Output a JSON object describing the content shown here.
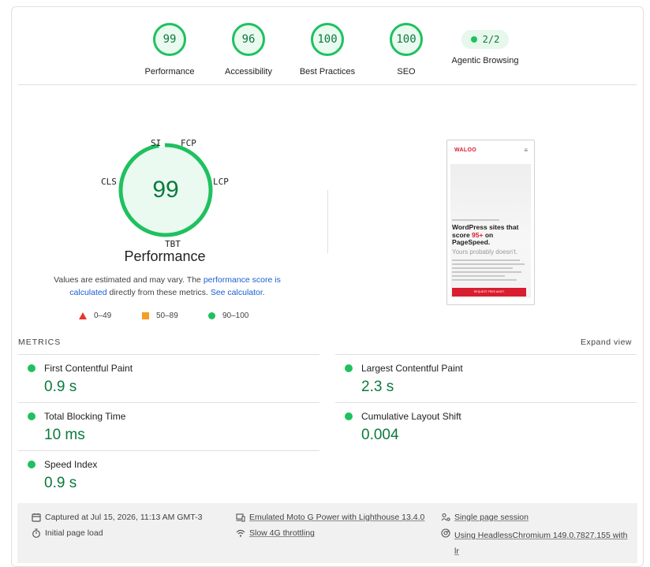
{
  "top_gauges": [
    {
      "score": "99",
      "label": "Performance"
    },
    {
      "score": "96",
      "label": "Accessibility"
    },
    {
      "score": "100",
      "label": "Best Practices"
    },
    {
      "score": "100",
      "label": "SEO"
    },
    {
      "score": "2/2",
      "label": "Agentic Browsing"
    }
  ],
  "performance": {
    "score": "99",
    "title": "Performance",
    "gauge_labels": {
      "si": "SI",
      "fcp": "FCP",
      "lcp": "LCP",
      "tbt": "TBT",
      "cls": "CLS"
    },
    "desc_1": "Values are estimated and may vary. The ",
    "desc_link_1": "performance score is calculated",
    "desc_2": " directly from these metrics. ",
    "desc_link_2": "See calculator",
    "desc_3": "."
  },
  "legend": {
    "fail": "0–49",
    "average": "50–89",
    "pass": "90–100"
  },
  "thumbnail": {
    "brand": "WALOO",
    "menu": "≡",
    "headline_1": "WordPress sites that score ",
    "headline_red": "95+",
    "headline_2": " on PageSpeed.",
    "sub": "Yours probably doesn't.",
    "cta": "REQUEST FREE AUDIT"
  },
  "metrics": {
    "header": "METRICS",
    "expand": "Expand view",
    "items": [
      {
        "name": "First Contentful Paint",
        "value": "0.9 s"
      },
      {
        "name": "Largest Contentful Paint",
        "value": "2.3 s"
      },
      {
        "name": "Total Blocking Time",
        "value": "10 ms"
      },
      {
        "name": "Cumulative Layout Shift",
        "value": "0.004"
      },
      {
        "name": "Speed Index",
        "value": "0.9 s"
      }
    ]
  },
  "footer": {
    "captured": "Captured at Jul 15, 2026, 11:13 AM GMT-3",
    "initial": "Initial page load",
    "emulated": "Emulated Moto G Power with Lighthouse 13.4.0",
    "throttling": "Slow 4G throttling",
    "session": "Single page session",
    "browser": "Using HeadlessChromium 149.0.7827.155 with lr"
  },
  "colors": {
    "pass": "#1fc15f",
    "pass_text": "#0b7a3c",
    "fail": "#e8362b",
    "average": "#f79b23",
    "link": "#1a5fd1"
  }
}
